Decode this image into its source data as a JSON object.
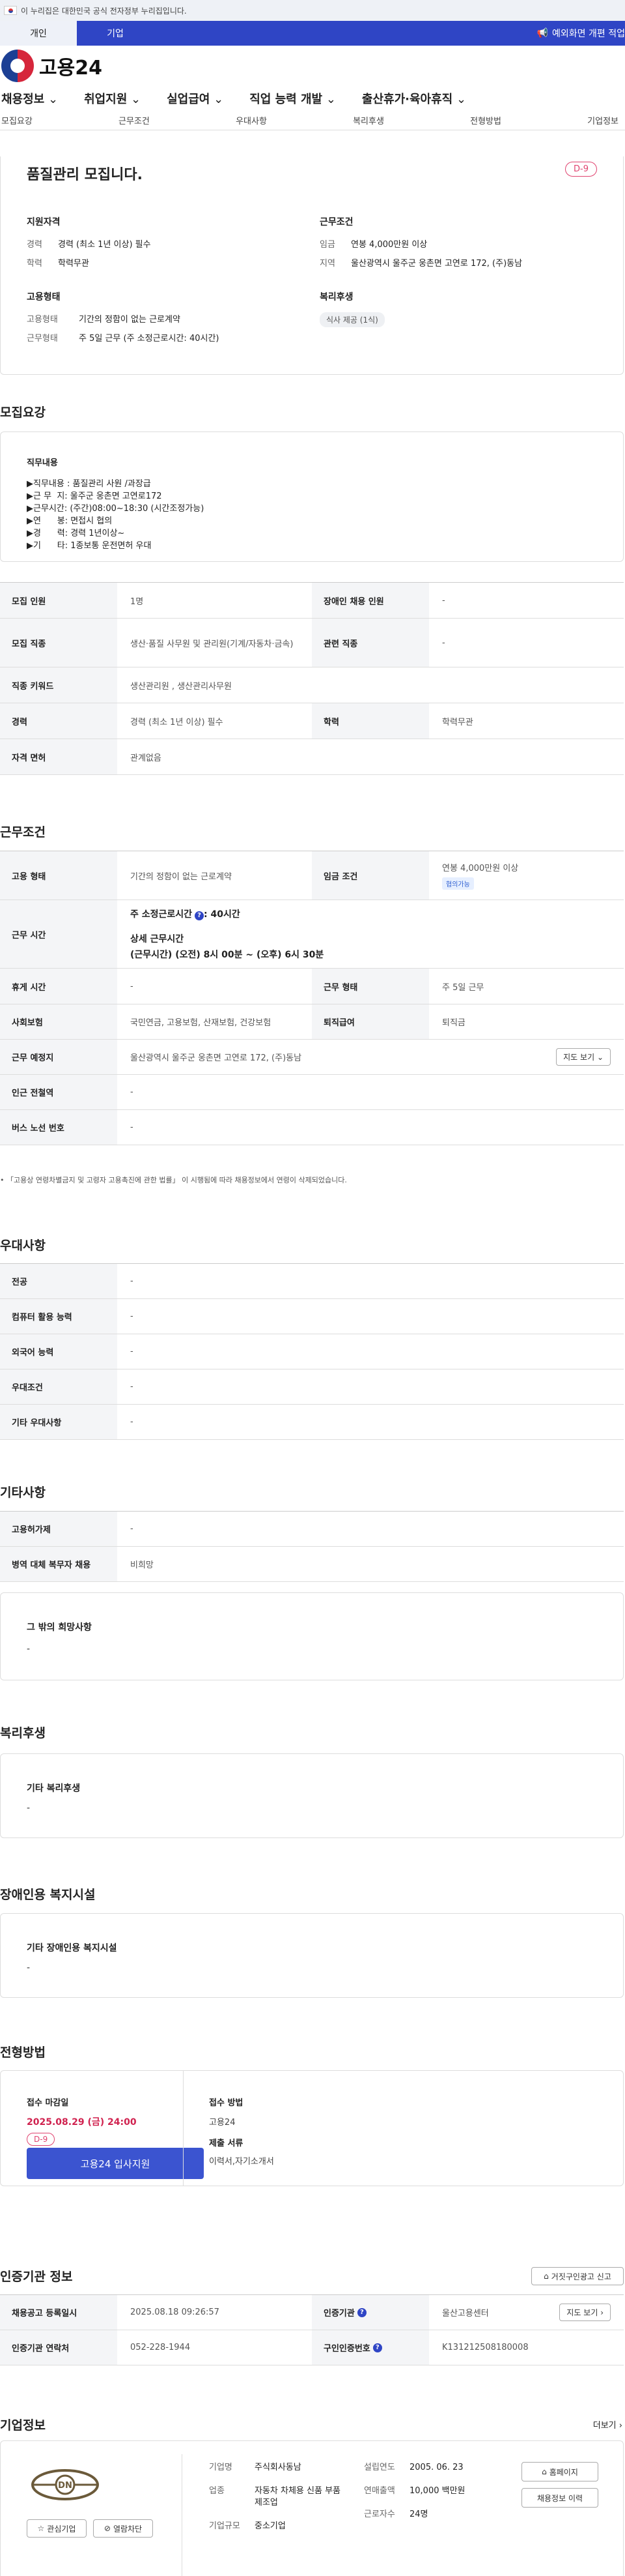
{
  "gov": {
    "notice": "이 누리집은 대한민국 공식 전자정부 누리집입니다."
  },
  "tabs": {
    "personal": "개인",
    "company": "기업",
    "notice": "예외화면 개편 적업"
  },
  "brand": {
    "name": "고용24"
  },
  "gnb": [
    "채용정보",
    "취업지원",
    "실업급여",
    "직업 능력 개발",
    "출산휴가·육아휴직"
  ],
  "subnav": [
    "모집요강",
    "근무조건",
    "우대사항",
    "복리후생",
    "전형방법",
    "기업정보"
  ],
  "summary": {
    "title": "품질관리 모집니다.",
    "dday": "D-9",
    "qual": {
      "h": "지원자격",
      "items": [
        {
          "k": "경력",
          "v": "경력 (최소 1년 이상) 필수"
        },
        {
          "k": "학력",
          "v": "학력무관"
        }
      ]
    },
    "cond": {
      "h": "근무조건",
      "items": [
        {
          "k": "임금",
          "v": "연봉 4,000만원 이상"
        },
        {
          "k": "지역",
          "v": "울산광역시 울주군 웅촌면 고연로 172, (주)동남"
        }
      ]
    },
    "type": {
      "h": "고용형태",
      "items": [
        {
          "k": "고용형태",
          "v": "기간의 정함이 없는 근로계약"
        },
        {
          "k": "근무형태",
          "v": "주 5일 근무 (주 소정근로시간: 40시간)"
        }
      ]
    },
    "welfare": {
      "h": "복리후생",
      "tag": "식사 제공 (1식)"
    }
  },
  "recruit": {
    "h": "모집요강",
    "duty_h": "직무내용",
    "duty_lines": [
      "▶직무내용 : 품질관리 사원 /과장급",
      "▶근 무  지: 울주군 웅촌면 고연로172",
      "▶근무시간: (주간)08:00~18:30 (시간조정가능)",
      "▶연      봉: 면접시 협의",
      "▶경      력: 경력 1년이상~",
      "▶기      타: 1종보통 운전면허 우대"
    ],
    "rows": [
      [
        "모집 인원",
        "1명",
        "장애인 채용 인원",
        "-"
      ],
      [
        "모집 직종",
        "생산·품질 사무원 및 관리원(기계/자동차·금속)",
        "관련 직종",
        "-"
      ],
      [
        "직종 키워드",
        "생산관리원 , 생산관리사무원"
      ],
      [
        "경력",
        "경력 (최소 1년 이상) 필수",
        "학력",
        "학력무관"
      ],
      [
        "자격 면허",
        "관계없음"
      ]
    ]
  },
  "work": {
    "h": "근무조건",
    "emp_type_k": "고용 형태",
    "emp_type_v": "기간의 정함이 없는 근로계약",
    "wage_k": "임금 조건",
    "wage_v": "연봉 4,000만원 이상",
    "wage_chip": "협의가능",
    "time_k": "근무 시간",
    "time_main": "주 소정근로시간",
    "time_main_v": ": 40시간",
    "time_detail_h": "상세 근무시간",
    "time_detail": "(근무시간) (오전) 8시 00분 ~ (오후) 6시 30분",
    "rest_k": "휴게 시간",
    "rest_v": "-",
    "form_k": "근무 형태",
    "form_v": "주 5일 근무",
    "ins_k": "사회보험",
    "ins_v": "국민연금, 고용보험, 산재보험, 건강보험",
    "ret_k": "퇴직급여",
    "ret_v": "퇴직금",
    "place_k": "근무 예정지",
    "place_v": "울산광역시 울주군 웅촌면 고연로 172, (주)동남",
    "map_btn": "지도 보기",
    "station_k": "인근 전철역",
    "station_v": "-",
    "bus_k": "버스 노선 번호",
    "bus_v": "-",
    "note": "「고용상 연령차별금지 및 고령자 고용촉진에 관한 법률」 이 시행됨에 따라 채용정보에서 연령이 삭제되었습니다."
  },
  "pref": {
    "h": "우대사항",
    "rows": [
      [
        "전공",
        "-"
      ],
      [
        "컴퓨터 활용 능력",
        "-"
      ],
      [
        "외국어 능력",
        "-"
      ],
      [
        "우대조건",
        "-"
      ],
      [
        "기타 우대사항",
        "-"
      ]
    ]
  },
  "etc": {
    "h": "기타사항",
    "rows": [
      [
        "고용허가제",
        "-"
      ],
      [
        "병역 대체 복무자 채용",
        "비희망"
      ]
    ],
    "wish_h": "그 밖의 희망사항",
    "wish_v": "-"
  },
  "benefit": {
    "h": "복리후생",
    "t": "기타 복리후생",
    "v": "-"
  },
  "disabled": {
    "h": "장애인용 복지시설",
    "t": "기타 장애인용 복지시설",
    "v": "-"
  },
  "select": {
    "h": "전형방법",
    "deadline_h": "접수 마감일",
    "deadline": "2025.08.29 (금) 24:00",
    "dday": "D-9",
    "apply": "고용24 입사지원",
    "method_h": "접수 방법",
    "method": "고용24",
    "docs_h": "제출 서류",
    "docs": "이력서,자기소개서"
  },
  "cert": {
    "h": "인증기관 정보",
    "report": "거짓구인광고 신고",
    "rows": [
      [
        "채용공고 등록일시",
        "2025.08.18 09:26:57",
        "인증기관",
        "울산고용센터"
      ],
      [
        "인증기관 연락처",
        "052-228-1944",
        "구인인증번호",
        "K131212508180008"
      ]
    ],
    "map_btn": "지도 보기"
  },
  "company": {
    "h": "기업정보",
    "more": "더보기",
    "fav": "관심기업",
    "block": "열람차단",
    "logo": "DN",
    "items": [
      [
        "기업명",
        "주식회사동남"
      ],
      [
        "업종",
        "자동차 차체용 신품 부품 제조업"
      ],
      [
        "기업규모",
        "중소기업"
      ]
    ],
    "items2": [
      [
        "설립연도",
        "2005. 06. 23"
      ],
      [
        "연매출액",
        "10,000 백만원"
      ],
      [
        "근로자수",
        "24명"
      ]
    ],
    "home": "홈페이지",
    "history": "채용정보 이력"
  }
}
